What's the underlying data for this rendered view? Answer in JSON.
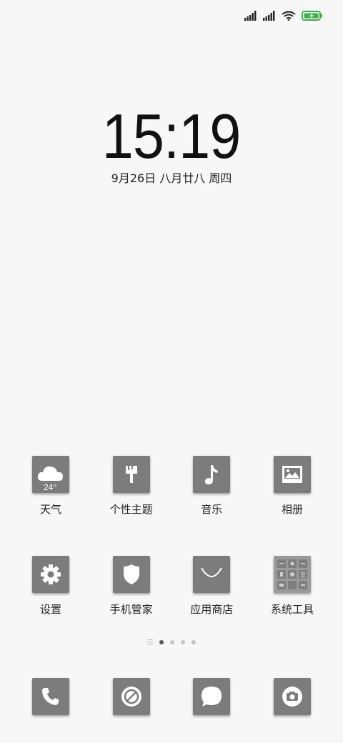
{
  "status": {
    "sim1_icon": "signal-icon",
    "sim2_icon": "signal-icon",
    "wifi_icon": "wifi-icon",
    "battery_icon": "battery-charging-icon",
    "battery_color": "#3bb34a"
  },
  "clock": {
    "time": "15:19"
  },
  "date": {
    "text": "9月26日 八月廿八 周四"
  },
  "apps": [
    {
      "label": "天气",
      "icon": "weather-icon",
      "temp": "24°"
    },
    {
      "label": "个性主题",
      "icon": "theme-brush-icon"
    },
    {
      "label": "音乐",
      "icon": "music-note-icon"
    },
    {
      "label": "相册",
      "icon": "gallery-icon"
    },
    {
      "label": "设置",
      "icon": "gear-icon"
    },
    {
      "label": "手机管家",
      "icon": "shield-icon"
    },
    {
      "label": "应用商店",
      "icon": "app-store-icon"
    },
    {
      "label": "系统工具",
      "icon": "folder-grid-icon"
    }
  ],
  "pager": {
    "pages": 4,
    "active_page": 1
  },
  "dock": [
    {
      "icon": "phone-icon"
    },
    {
      "icon": "browser-icon"
    },
    {
      "icon": "message-icon"
    },
    {
      "icon": "camera-icon"
    }
  ],
  "icon_color": "#7c7c7c"
}
